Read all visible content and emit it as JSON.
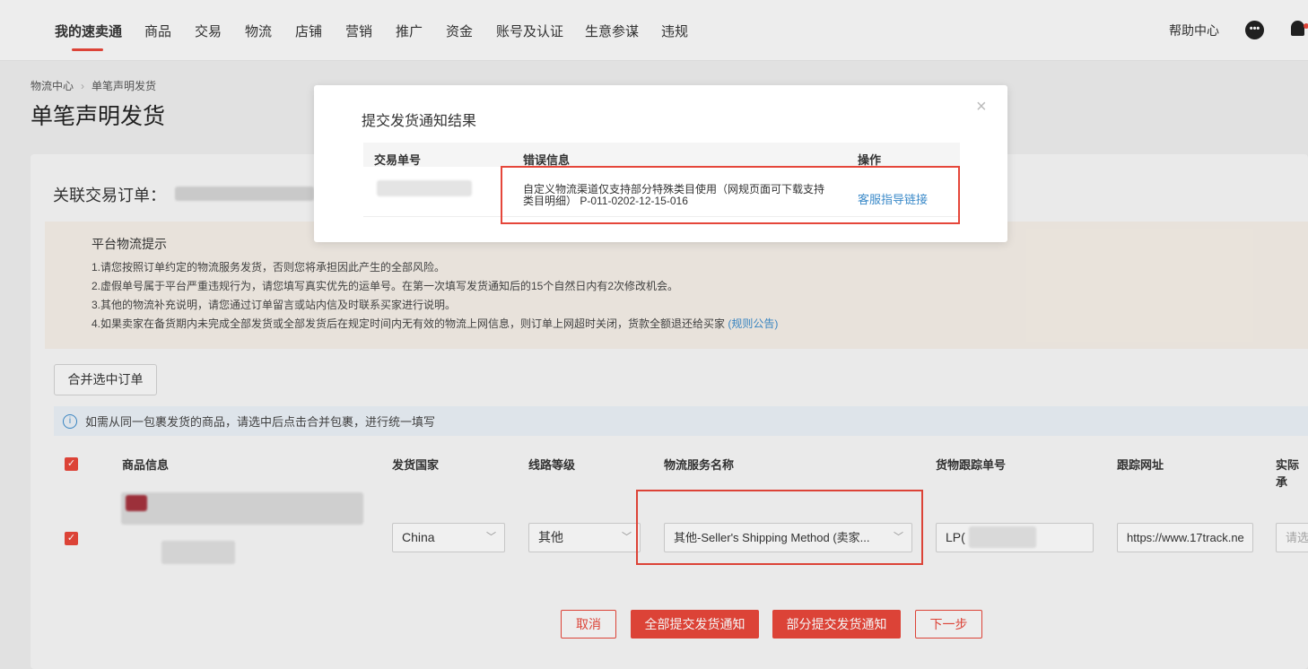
{
  "nav": {
    "items": [
      "我的速卖通",
      "商品",
      "交易",
      "物流",
      "店铺",
      "营销",
      "推广",
      "资金",
      "账号及认证",
      "生意参谋",
      "违规"
    ],
    "help": "帮助中心"
  },
  "breadcrumb": {
    "parent": "物流中心",
    "current": "单笔声明发货"
  },
  "page_title": "单笔声明发货",
  "order": {
    "label": "关联交易订单："
  },
  "tips": {
    "title": "平台物流提示",
    "lines": [
      "1.请您按照订单约定的物流服务发货，否则您将承担因此产生的全部风险。",
      "2.虚假单号属于平台严重违规行为，请您填写真实优先的运单号。在第一次填写发货通知后的15个自然日内有2次修改机会。",
      "3.其他的物流补充说明，请您通过订单留言或站内信及时联系买家进行说明。",
      "4.如果卖家在备货期内未完成全部发货或全部发货后在规定时间内无有效的物流上网信息，则订单上网超时关闭，货款全额退还给买家"
    ],
    "rule_link": "(规则公告)"
  },
  "merge_button": "合并选中订单",
  "info": "如需从同一包裹发货的商品，请选中后点击合并包裹，进行统一填写",
  "table": {
    "headers": [
      "商品信息",
      "发货国家",
      "线路等级",
      "物流服务名称",
      "货物跟踪单号",
      "跟踪网址",
      "实际承"
    ],
    "row": {
      "country": "China",
      "level": "其他",
      "service": "其他-Seller's Shipping Method (卖家...",
      "tracking": "LP(",
      "url": "https://www.17track.ne",
      "actual_placeholder": "请选"
    }
  },
  "buttons": {
    "cancel": "取消",
    "submit_all": "全部提交发货通知",
    "submit_partial": "部分提交发货通知",
    "next": "下一步"
  },
  "modal": {
    "title": "提交发货通知结果",
    "headers": {
      "order_no": "交易单号",
      "error": "错误信息",
      "action": "操作"
    },
    "error_text": "自定义物流渠道仅支持部分特殊类目使用（网规页面可下载支持类目明细） P-011-0202-12-15-016",
    "action_link": "客服指导链接",
    "close": "×"
  },
  "colors": {
    "accent": "#e5463a",
    "link": "#3b8ac9"
  },
  "icons": {
    "chat": "chat-bubble-icon",
    "bell": "bell-icon",
    "info": "info-icon",
    "close": "close-icon",
    "chevron": "chevron-down-icon"
  }
}
